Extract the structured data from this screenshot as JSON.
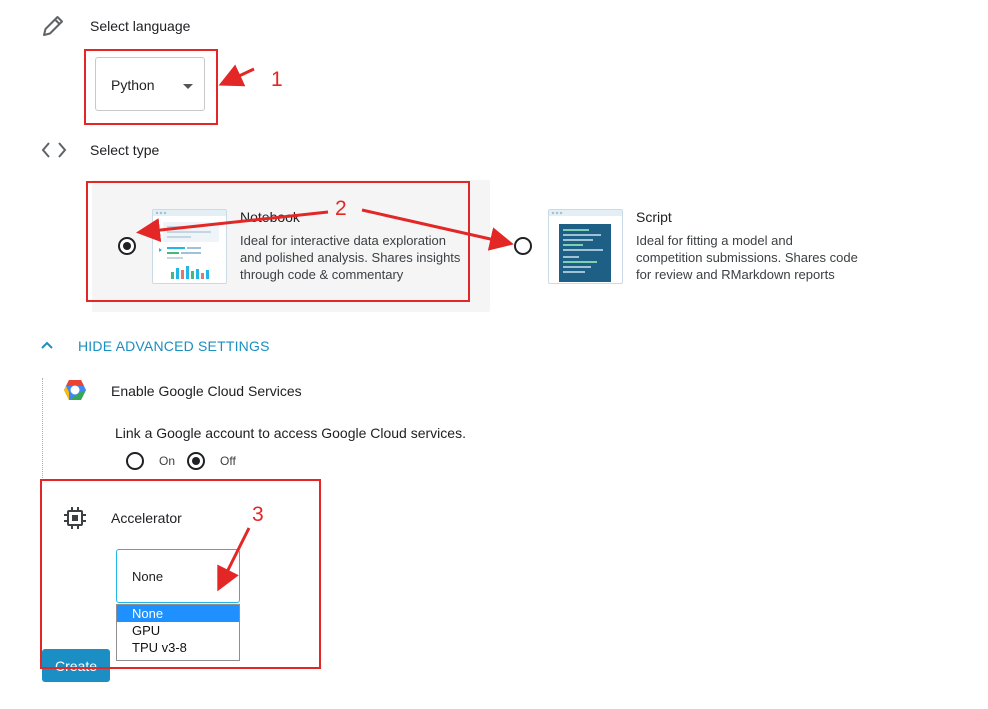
{
  "language": {
    "heading": "Select language",
    "icon": "pencil-icon",
    "selected": "Python"
  },
  "type": {
    "heading": "Select type",
    "icon": "code-brackets-icon",
    "options": [
      {
        "title": "Notebook",
        "description_lines": [
          "Ideal for interactive data exploration",
          "and polished analysis. Shares insights",
          "through code & commentary"
        ],
        "selected": true
      },
      {
        "title": "Script",
        "description_lines": [
          "Ideal for fitting a model and",
          "competition submissions. Shares code",
          "for review and RMarkdown reports"
        ],
        "selected": false
      }
    ]
  },
  "advanced": {
    "toggle_label": "HIDE ADVANCED SETTINGS",
    "google_cloud": {
      "title": "Enable Google Cloud Services",
      "description": "Link a Google account to access Google Cloud services.",
      "on_label": "On",
      "off_label": "Off",
      "value": "Off"
    },
    "accelerator": {
      "title": "Accelerator",
      "selected": "None",
      "options": [
        "None",
        "GPU",
        "TPU v3-8"
      ]
    }
  },
  "create_label": "Create",
  "annotations": [
    "1",
    "2",
    "3"
  ],
  "colors": {
    "accent": "#1a8fc0",
    "annotation": "#e32727",
    "dropdown_highlight": "#1e90ff"
  }
}
